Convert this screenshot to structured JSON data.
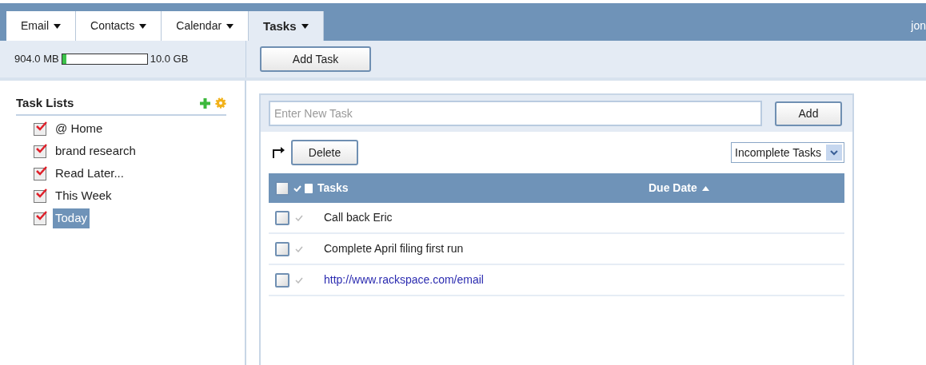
{
  "tabs": [
    {
      "label": "Email",
      "selected": false
    },
    {
      "label": "Contacts",
      "selected": false
    },
    {
      "label": "Calendar",
      "selected": false
    },
    {
      "label": "Tasks",
      "selected": true
    }
  ],
  "user": "jon",
  "storage": {
    "used": "904.0 MB",
    "total": "10.0 GB",
    "level": 0.05
  },
  "add_task_button": "Add Task",
  "sidebar": {
    "title": "Task Lists",
    "items": [
      {
        "label": "@ Home",
        "checked": true,
        "selected": false
      },
      {
        "label": "brand research",
        "checked": true,
        "selected": false
      },
      {
        "label": "Read Later...",
        "checked": true,
        "selected": false
      },
      {
        "label": "This Week",
        "checked": true,
        "selected": false
      },
      {
        "label": "Today",
        "checked": true,
        "selected": true
      }
    ]
  },
  "new_task": {
    "placeholder": "Enter New Task",
    "button": "Add"
  },
  "delete_button": "Delete",
  "filter": "Incomplete Tasks",
  "table": {
    "columns": [
      "Tasks",
      "Due Date"
    ],
    "all_checked": false,
    "rows": [
      {
        "task": "Call back Eric",
        "kind": "text",
        "checked": false
      },
      {
        "task": "Complete April filing first run",
        "kind": "text",
        "checked": false
      },
      {
        "task": "http://www.rackspace.com/email",
        "kind": "link",
        "checked": false
      }
    ]
  }
}
